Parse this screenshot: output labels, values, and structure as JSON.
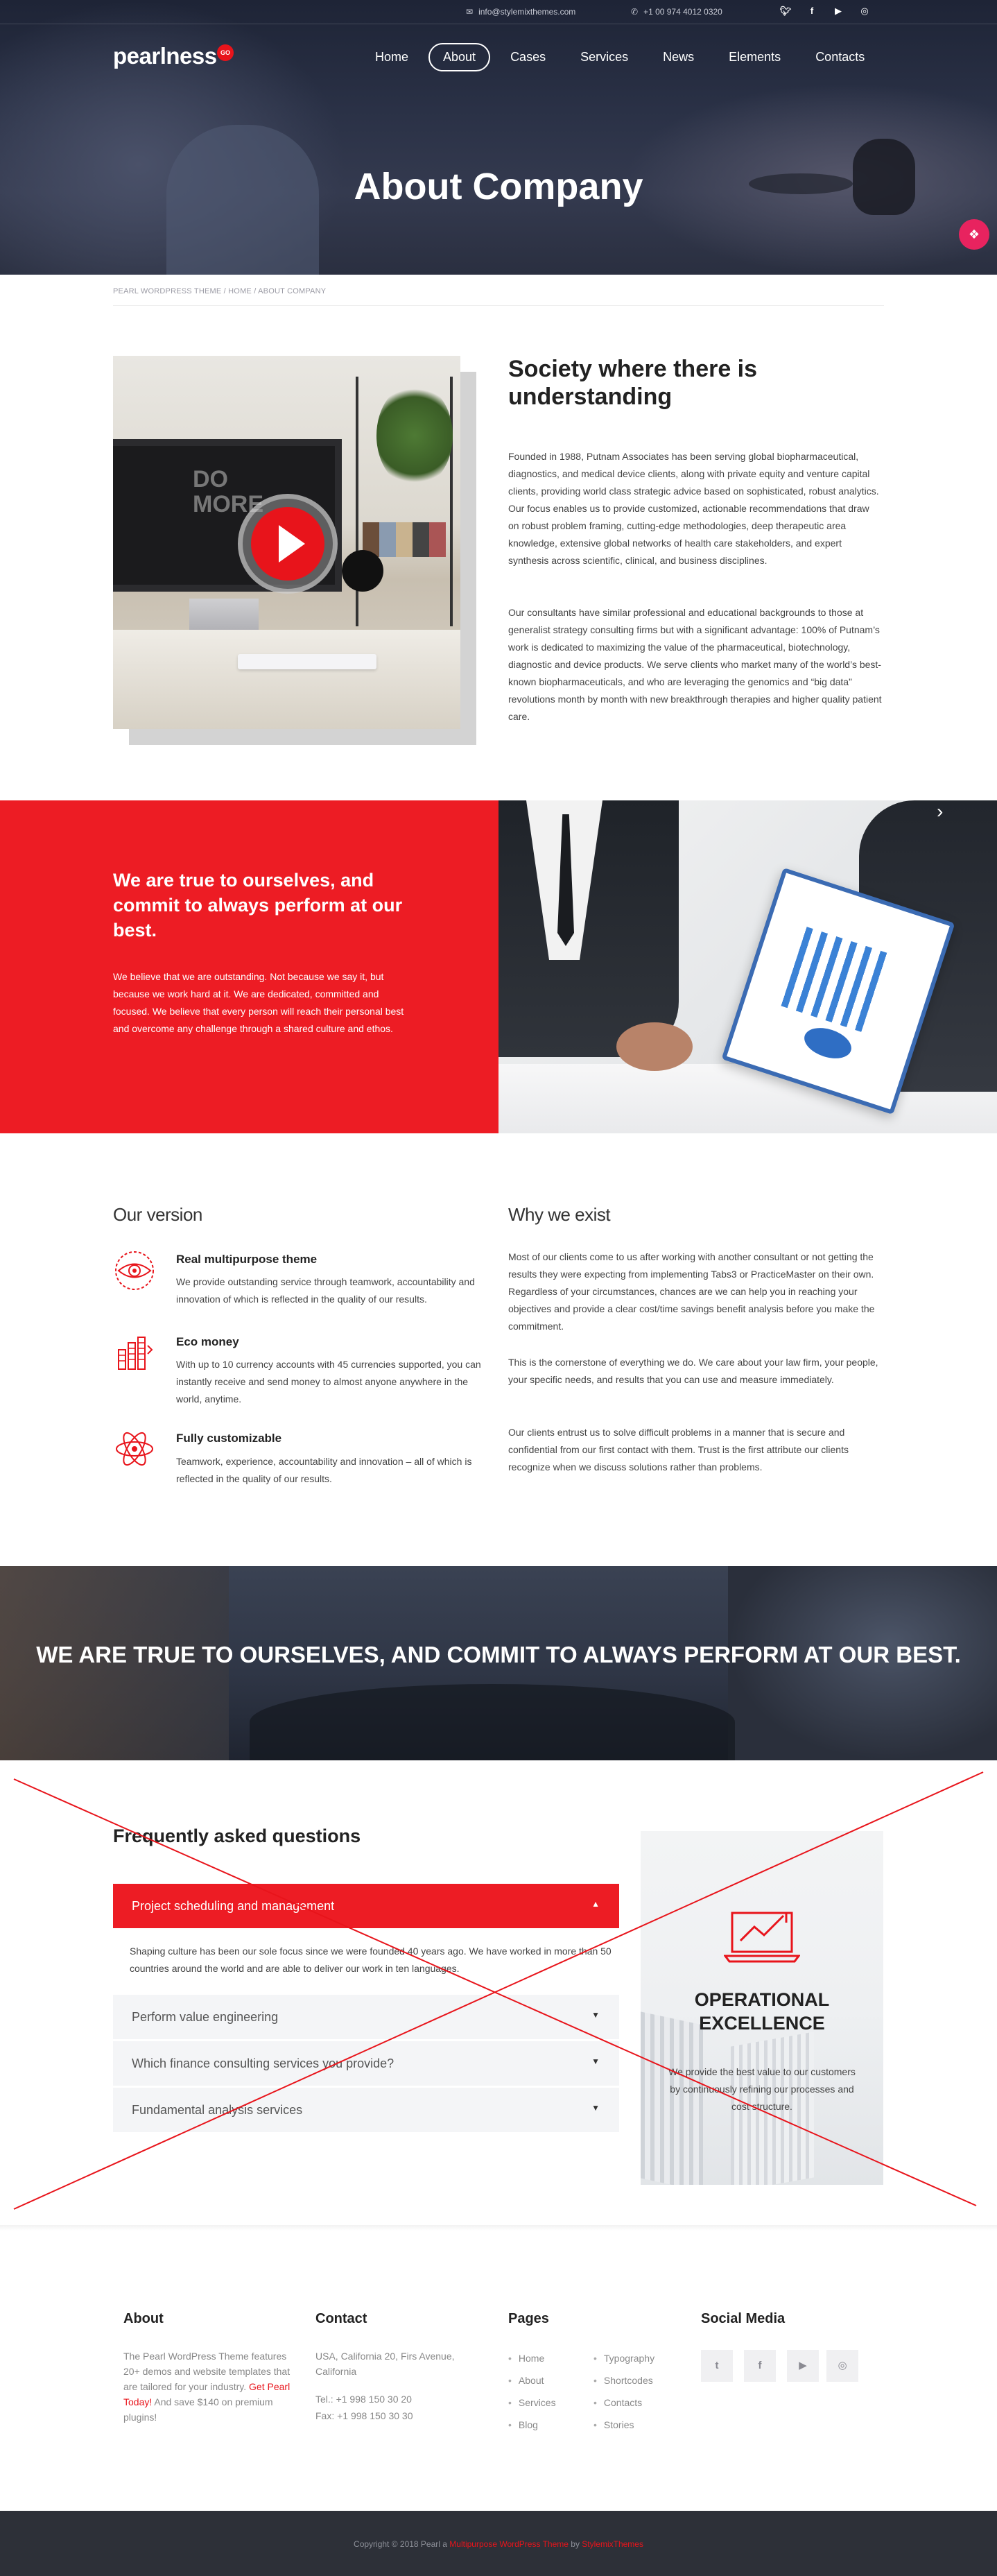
{
  "topbar": {
    "email": "info@stylemixthemes.com",
    "phone": "+1 00 974 4012 0320",
    "socials": [
      "twitter-icon",
      "facebook-icon",
      "youtube-icon",
      "instagram-icon"
    ]
  },
  "header": {
    "logo": "pearlness",
    "logo_badge": "GO",
    "nav": [
      "Home",
      "About",
      "Cases",
      "Services",
      "News",
      "Elements",
      "Contacts"
    ],
    "active_nav": "About"
  },
  "hero": {
    "title": "About Company"
  },
  "breadcrumb": "PEARL WORDPRESS THEME / HOME / ABOUT COMPANY",
  "intro": {
    "image_text": "DO MORE",
    "title": "Society where there is understanding",
    "p1": "Founded in 1988, Putnam Associates has been serving global biopharmaceutical, diagnostics, and medical device clients, along with private equity and venture capital clients, providing world class strategic advice based on sophisticated, robust analytics. Our focus enables us to provide customized, actionable recommendations that draw on robust problem framing, cutting-edge methodologies, deep therapeutic area knowledge, extensive global networks of health care stakeholders, and expert synthesis across scientific, clinical, and business disciplines.",
    "p2": "Our consultants have similar professional and educational backgrounds to those at generalist strategy consulting firms but with a significant advantage: 100% of Putnam’s work is dedicated to maximizing the value of the pharmaceutical, biotechnology, diagnostic and device products. We serve clients who market many of the world’s best-known biopharmaceuticals, and who are leveraging the genomics and “big data” revolutions month by month with new breakthrough therapies and higher quality patient care."
  },
  "red_band": {
    "title": "We are true to ourselves, and commit to always perform at our best.",
    "text": "We believe that we are outstanding. Not because we say it, but because we work hard at it. We are dedicated, committed and focused. We believe that every person will reach their personal best and overcome any challenge through a shared culture and ethos."
  },
  "version": {
    "heading": "Our version",
    "features": [
      {
        "title": "Real multipurpose theme",
        "text": "We provide outstanding service through teamwork, accountability and innovation of which is reflected in the quality of our results.",
        "icon": "eye-target-icon"
      },
      {
        "title": "Eco money",
        "text": "With up to 10 currency accounts with 45 currencies supported, you can instantly receive and send money to almost anyone anywhere in the world, anytime.",
        "icon": "coin-stack-icon"
      },
      {
        "title": "Fully customizable",
        "text": "Teamwork, experience, accountability and innovation – all of which is reflected in the quality of our results.",
        "icon": "atom-icon"
      }
    ]
  },
  "why": {
    "heading": "Why we exist",
    "p1": "Most of our clients come to us after working with another consultant or not getting the results they were expecting from implementing Tabs3 or PracticeMaster on their own. Regardless of your circumstances, chances are we can help you in reaching your objectives and provide a clear cost/time savings benefit analysis before you make the commitment.",
    "p2": "This is the cornerstone of everything we do. We care about your law firm, your people, your specific needs, and results that you can use and measure immediately.",
    "p3": "Our clients entrust us to solve difficult problems in a manner that is secure and confidential from our first contact with them. Trust is the first attribute our clients recognize when we discuss solutions rather than problems."
  },
  "banner": {
    "title": "WE ARE TRUE TO OURSELVES, AND COMMIT TO ALWAYS PERFORM AT OUR BEST."
  },
  "faq": {
    "title": "Frequently asked questions",
    "items": [
      {
        "q": "Project scheduling and management",
        "open": true
      },
      {
        "q": "Perform value engineering",
        "open": false
      },
      {
        "q": "Which finance consulting services you provide?",
        "open": false
      },
      {
        "q": "Fundamental analysis services",
        "open": false
      }
    ],
    "answer": "Shaping culture has been our sole focus since we were founded 40 years ago. We have worked in more than 50 countries around the world and are able to deliver our work in ten languages."
  },
  "ops": {
    "title": "OPERATIONAL EXCELLENCE",
    "text": "We provide the best value to our customers by continuously refining our processes and cost structure."
  },
  "footer": {
    "about": {
      "heading": "About",
      "text": "The Pearl WordPress Theme features 20+ demos and website templates that are tailored for your industry.",
      "cta": "Get Pearl Today!",
      "cta_tail": " And save $140 on premium plugins!"
    },
    "contact": {
      "heading": "Contact",
      "address": "USA, California 20, Firs Avenue, California",
      "tel": "Tel.: +1 998 150 30 20",
      "fax": "Fax: +1 998 150 30 30"
    },
    "pages": {
      "heading": "Pages",
      "col1": [
        "Home",
        "About",
        "Services",
        "Blog"
      ],
      "col2": [
        "Typography",
        "Shortcodes",
        "Contacts",
        "Stories"
      ]
    },
    "social": {
      "heading": "Social Media",
      "icons": [
        "twitter-icon",
        "facebook-icon",
        "youtube-icon",
        "instagram-icon"
      ]
    },
    "copyright_pre": "Copyright © 2018 Pearl a ",
    "copyright_link1": "Multipurpose WordPress Theme",
    "copyright_mid": " by ",
    "copyright_link2": "StylemixThemes"
  },
  "colors": {
    "accent": "#ed1c24",
    "dark": "#2d3038"
  }
}
